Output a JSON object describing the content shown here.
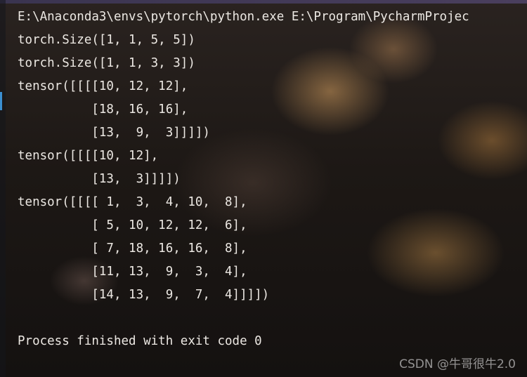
{
  "console": {
    "lines": [
      "E:\\Anaconda3\\envs\\pytorch\\python.exe E:\\Program\\PycharmProjec",
      "torch.Size([1, 1, 5, 5])",
      "torch.Size([1, 1, 3, 3])",
      "tensor([[[[10, 12, 12],",
      "          [18, 16, 16],",
      "          [13,  9,  3]]]])",
      "tensor([[[[10, 12],",
      "          [13,  3]]]])",
      "tensor([[[[ 1,  3,  4, 10,  8],",
      "          [ 5, 10, 12, 12,  6],",
      "          [ 7, 18, 16, 16,  8],",
      "          [11, 13,  9,  3,  4],",
      "          [14, 13,  9,  7,  4]]]])",
      "",
      "Process finished with exit code 0"
    ]
  },
  "watermark": {
    "text": "CSDN @牛哥很牛2.0"
  },
  "colors": {
    "text": "#ece8e3",
    "gutter_marker": "#3b8fd0",
    "top_strip": "#4a3f5e"
  }
}
